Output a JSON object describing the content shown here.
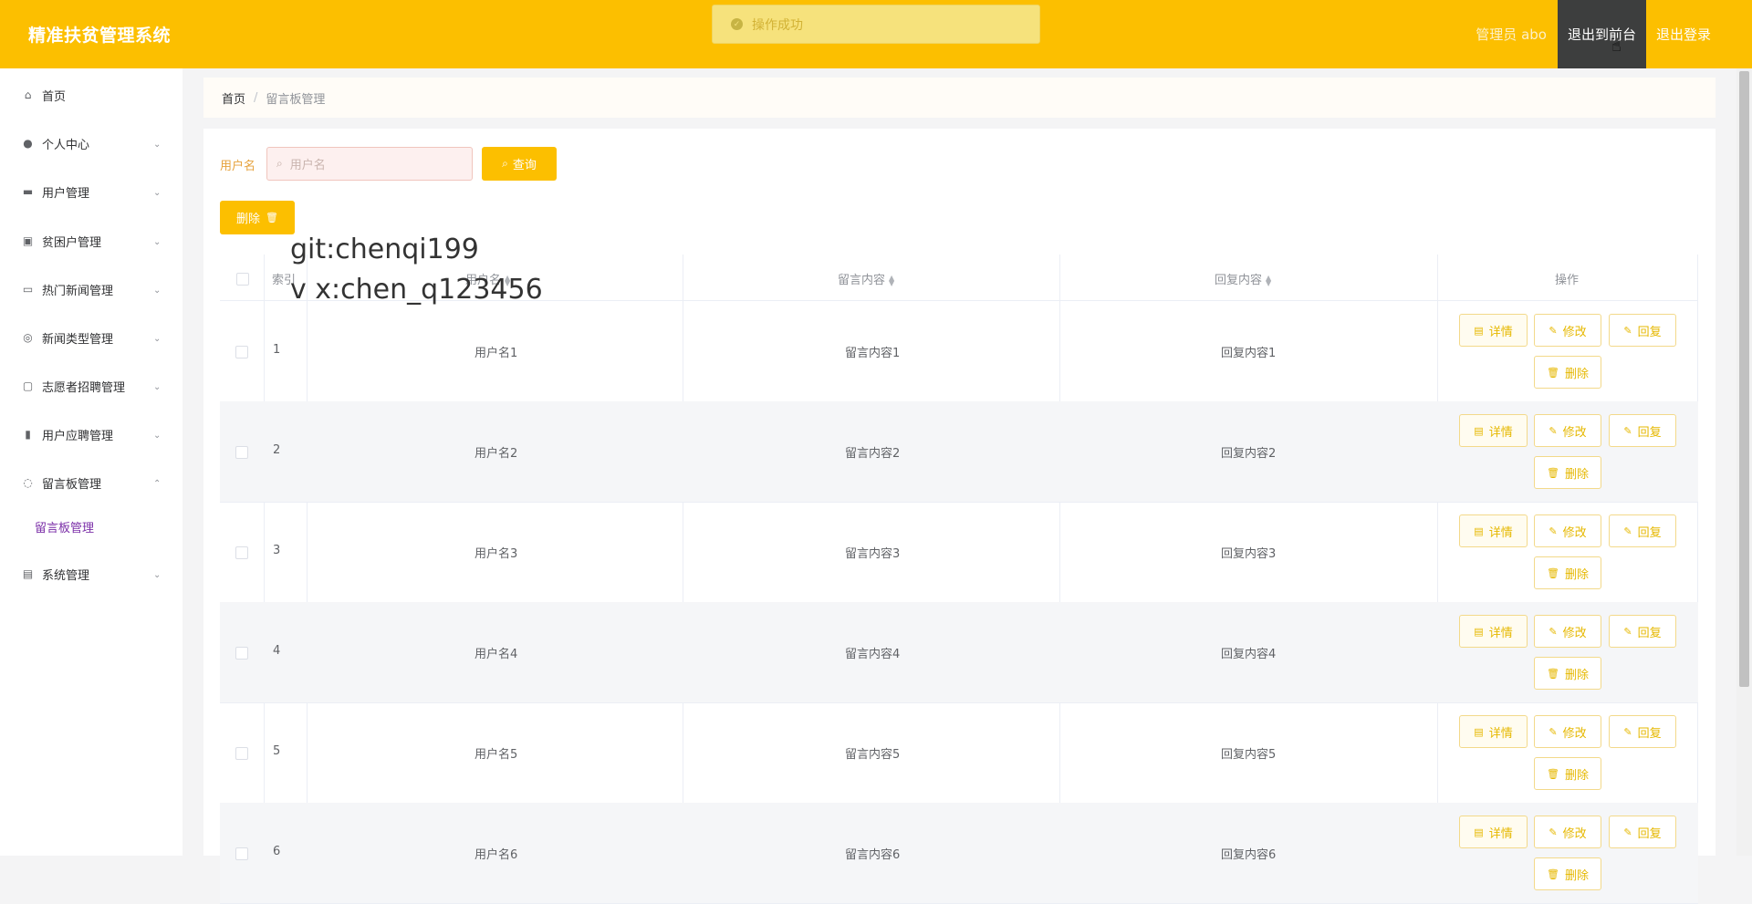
{
  "app": {
    "title": "精准扶贫管理系统"
  },
  "toast": {
    "message": "操作成功"
  },
  "header": {
    "admin_label": "管理员 abo",
    "front_label": "退出到前台",
    "logout_label": "退出登录"
  },
  "sidebar": {
    "items": [
      {
        "label": "首页"
      },
      {
        "label": "个人中心"
      },
      {
        "label": "用户管理"
      },
      {
        "label": "贫困户管理"
      },
      {
        "label": "热门新闻管理"
      },
      {
        "label": "新闻类型管理"
      },
      {
        "label": "志愿者招聘管理"
      },
      {
        "label": "用户应聘管理"
      },
      {
        "label": "留言板管理"
      },
      {
        "label": "系统管理"
      }
    ],
    "submenu": {
      "label": "留言板管理"
    }
  },
  "breadcrumb": {
    "home": "首页",
    "separator": "/",
    "current": "留言板管理"
  },
  "search": {
    "label": "用户名",
    "placeholder": "用户名",
    "query_label": "查询"
  },
  "toolbar": {
    "delete_label": "删除"
  },
  "watermark": {
    "line1": "git:chenqi199",
    "line2": "v x:chen_q123456"
  },
  "table": {
    "headers": {
      "index": "索引",
      "username": "用户名",
      "message": "留言内容",
      "reply": "回复内容",
      "actions": "操作"
    },
    "action_labels": {
      "detail": "详情",
      "edit": "修改",
      "reply": "回复",
      "delete": "删除"
    },
    "rows": [
      {
        "index": "1",
        "username": "用户名1",
        "message": "留言内容1",
        "reply": "回复内容1"
      },
      {
        "index": "2",
        "username": "用户名2",
        "message": "留言内容2",
        "reply": "回复内容2"
      },
      {
        "index": "3",
        "username": "用户名3",
        "message": "留言内容3",
        "reply": "回复内容3"
      },
      {
        "index": "4",
        "username": "用户名4",
        "message": "留言内容4",
        "reply": "回复内容4"
      },
      {
        "index": "5",
        "username": "用户名5",
        "message": "留言内容5",
        "reply": "回复内容5"
      },
      {
        "index": "6",
        "username": "用户名6",
        "message": "留言内容6",
        "reply": "回复内容6"
      }
    ]
  },
  "colors": {
    "accent": "#fcbf00",
    "header_active": "#3d3e3e",
    "submenu_active": "#7b2fa8"
  }
}
